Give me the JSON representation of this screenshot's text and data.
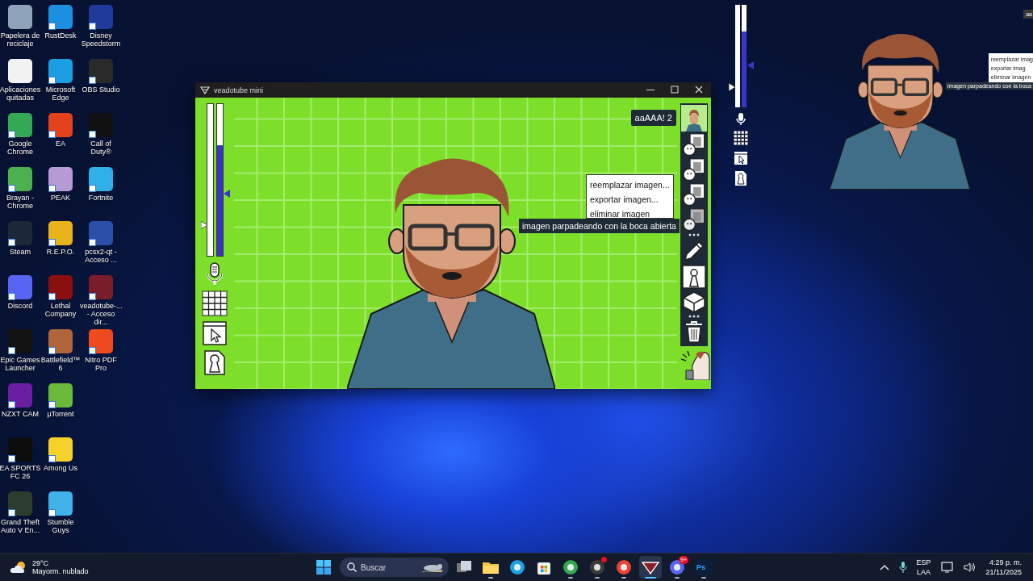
{
  "desktop": {
    "icon_rows": [
      [
        {
          "label": "Papelera de reciclaje",
          "color": "#8fa3b8",
          "shortcut": false
        },
        {
          "label": "RustDesk",
          "color": "#1d8fe0",
          "shortcut": true
        },
        {
          "label": "Disney Speedstorm",
          "color": "#1f3a9a",
          "shortcut": true
        }
      ],
      [
        {
          "label": "Aplicaciones quitadas",
          "color": "#f2f2f2",
          "shortcut": false
        },
        {
          "label": "Microsoft Edge",
          "color": "#1b9de2",
          "shortcut": true
        },
        {
          "label": "OBS Studio",
          "color": "#2a2a2a",
          "shortcut": true
        }
      ],
      [
        {
          "label": "Google Chrome",
          "color": "#34a853",
          "shortcut": true
        },
        {
          "label": "EA",
          "color": "#e2421c",
          "shortcut": true
        },
        {
          "label": "Call of Duty®",
          "color": "#111111",
          "shortcut": true
        }
      ],
      [
        {
          "label": "Brayan - Chrome",
          "color": "#4caf50",
          "shortcut": true
        },
        {
          "label": "PEAK",
          "color": "#b59ad6",
          "shortcut": true
        },
        {
          "label": "Fortnite",
          "color": "#2fb0e8",
          "shortcut": true
        }
      ],
      [
        {
          "label": "Steam",
          "color": "#1b2838",
          "shortcut": true
        },
        {
          "label": "R.E.P.O.",
          "color": "#e7b21a",
          "shortcut": true
        },
        {
          "label": "pcsx2-qt - Acceso ...",
          "color": "#2b4fa8",
          "shortcut": true
        }
      ],
      [
        {
          "label": "Discord",
          "color": "#5865f2",
          "shortcut": true
        },
        {
          "label": "Lethal Company",
          "color": "#8a1010",
          "shortcut": true
        },
        {
          "label": "veadotube-... - Acceso dir...",
          "color": "#7a1d2a",
          "shortcut": true
        }
      ],
      [
        {
          "label": "Epic Games Launcher",
          "color": "#121212",
          "shortcut": true
        },
        {
          "label": "Battlefield™ 6",
          "color": "#b0653a",
          "shortcut": true
        },
        {
          "label": "Nitro PDF Pro",
          "color": "#ee4a1e",
          "shortcut": true
        }
      ],
      [
        {
          "label": "NZXT CAM",
          "color": "#6a1fa3",
          "shortcut": true
        },
        {
          "label": "µTorrent",
          "color": "#6ab93a",
          "shortcut": true
        }
      ],
      [
        {
          "label": "EA SPORTS FC 26",
          "color": "#0c0c0c",
          "shortcut": true
        },
        {
          "label": "Among Us",
          "color": "#f5d22a",
          "shortcut": true
        }
      ],
      [
        {
          "label": "Grand Theft Auto V En...",
          "color": "#2b3d2c",
          "shortcut": true
        },
        {
          "label": "Stumble Guys",
          "color": "#3fb3e8",
          "shortcut": true
        }
      ]
    ]
  },
  "window": {
    "title": "veadotube mini",
    "badge": "aaAAA! 2",
    "meters": [
      {
        "level": 0,
        "slider": {
          "level": 0.2
        }
      },
      {
        "level": 0.73,
        "slider": {
          "level": 0.41
        }
      }
    ],
    "thumbnails": [
      {
        "kind": "avatar",
        "selected": true
      },
      {
        "kind": "state",
        "selected": false
      },
      {
        "kind": "state",
        "selected": false
      },
      {
        "kind": "state",
        "selected": false
      },
      {
        "kind": "state",
        "selected": true
      }
    ],
    "context_menu": [
      "reemplazar imagen...",
      "exportar imagen...",
      "eliminar imagen"
    ],
    "tooltip": "imagen parpadeando con la boca abierta"
  },
  "preview": {
    "badge": "aa",
    "meters": [
      {
        "level": 0,
        "slider": {
          "level": 0.2
        }
      },
      {
        "level": 0.74,
        "slider": {
          "level": 0.41
        }
      }
    ],
    "context_menu": [
      "reemplazar imag",
      "exportar imag",
      "eliminar imagen"
    ],
    "tooltip": "imagen parpadeando con la boca"
  },
  "taskbar": {
    "weather": {
      "temperature": "29°C",
      "condition": "Mayorm. nublado"
    },
    "search": {
      "placeholder": "Buscar"
    },
    "apps": [
      {
        "kind": "taskview",
        "color": "#cfd6e0",
        "running": false,
        "selected": false
      },
      {
        "kind": "folder",
        "color": "#f4c542",
        "running": true,
        "selected": false
      },
      {
        "kind": "circle",
        "color": "#1fa0e0",
        "running": false,
        "selected": false
      },
      {
        "kind": "store",
        "color": "#f0f0f0",
        "running": false,
        "selected": false
      },
      {
        "kind": "circle",
        "color": "#34a853",
        "running": true,
        "selected": false
      },
      {
        "kind": "circle",
        "color": "#3a3a3a",
        "running": true,
        "selected": false,
        "notification_dot": true
      },
      {
        "kind": "circle",
        "color": "#ea4335",
        "running": true,
        "selected": false
      },
      {
        "kind": "shield",
        "color": "#8b1e2e",
        "running": true,
        "selected": true
      },
      {
        "kind": "circle",
        "color": "#5865f2",
        "running": true,
        "selected": false,
        "badge": "9+"
      },
      {
        "kind": "label",
        "color": "#0b1f3a",
        "running": true,
        "selected": false,
        "label": "Ps"
      }
    ],
    "language": "ESP",
    "layout": "LAA",
    "time": "4:29 p. m.",
    "date": "21/11/2025"
  }
}
